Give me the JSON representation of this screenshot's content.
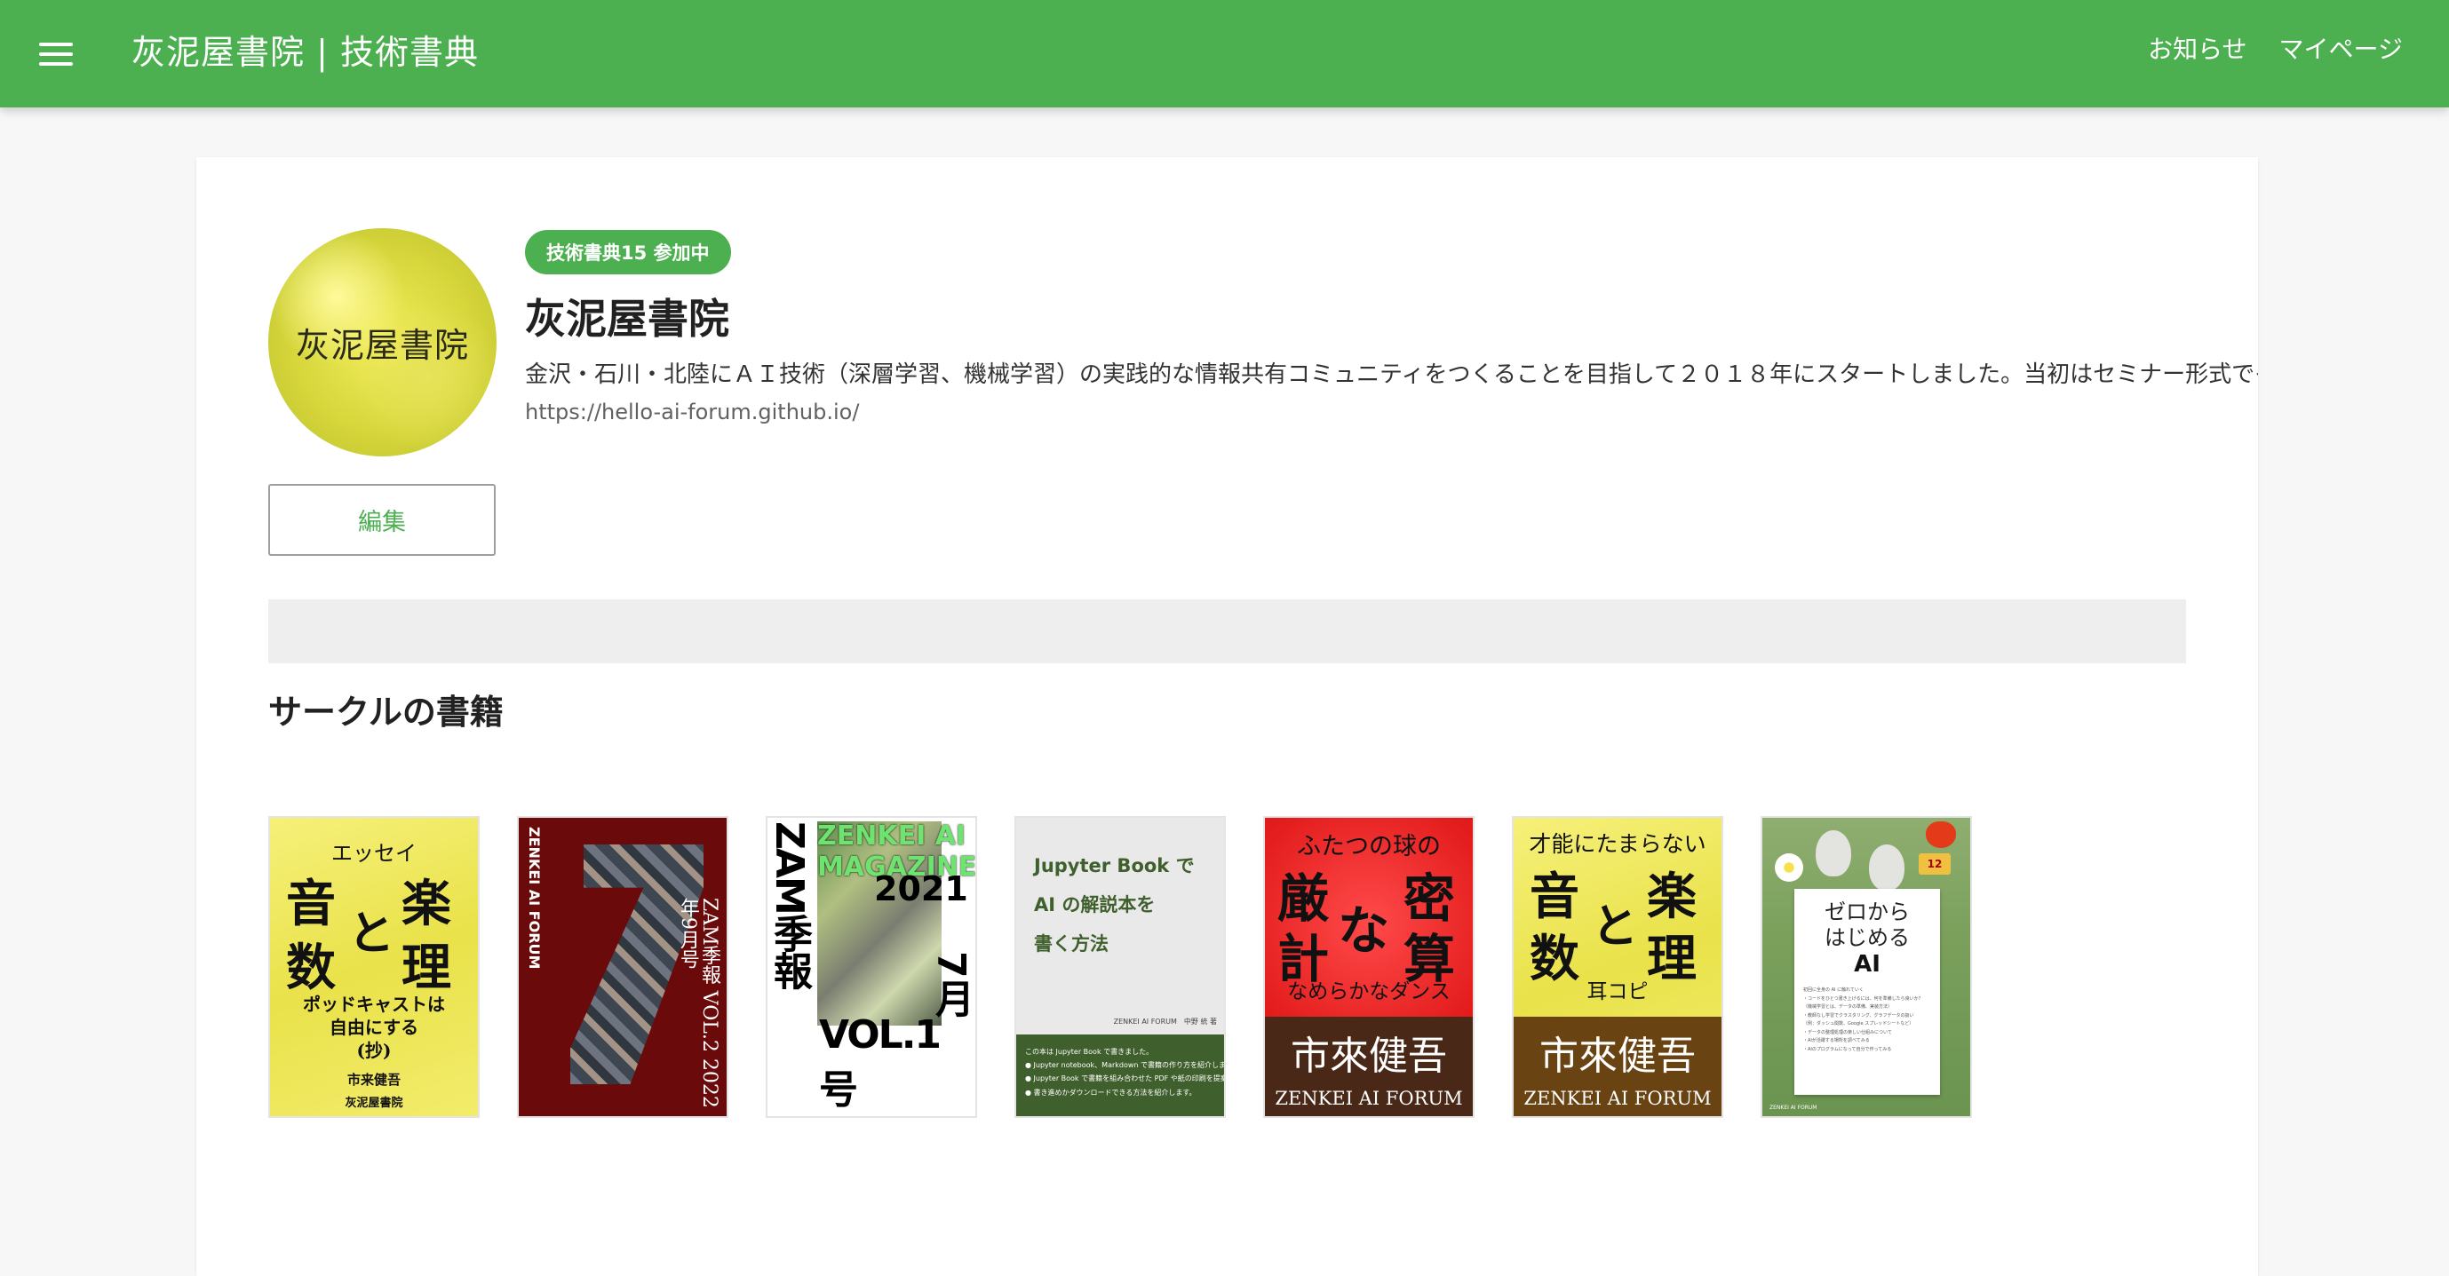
{
  "appbar": {
    "title": "灰泥屋書院 | 技術書典",
    "nav": [
      "お知らせ",
      "マイページ"
    ]
  },
  "circle": {
    "avatar_text": "灰泥屋書院",
    "badge": "技術書典15 参加中",
    "name": "灰泥屋書院",
    "description": "金沢・石川・北陸にＡＩ技術（深層学習、機械学習）の実践的な情報共有コミュニティをつくることを目指して２０１８年にスタートしました。当初はセミナー形式でイベン",
    "url": "https://hello-ai-forum.github.io/",
    "edit_label": "編集"
  },
  "section": {
    "title": "サークルの書籍"
  },
  "books": {
    "b1": {
      "top": "エッセイ",
      "c1": "音",
      "c2": "楽",
      "c3": "と",
      "c4": "数",
      "c5": "理",
      "sub1": "ポッドキャストは",
      "sub2": "自由にする",
      "sub3": "(抄)",
      "author": "市来健吾",
      "publisher": "灰泥屋書院"
    },
    "b2": {
      "vt": "ZENKEI AI FORUM",
      "vtitle": "ZAM季報 VOL.2 2022年9月号"
    },
    "b3": {
      "vbig": "ZAM季報",
      "green": "ZENKEI AI MAGAZINE",
      "year": "2021",
      "month": "7月",
      "vol": "VOL.1号"
    },
    "b4": {
      "l1": "Jupyter Book で",
      "l2": "AI の解説本を",
      "l3": "書く方法",
      "meta": "ZENKEI AI FORUM　中野 統 著",
      "f1": "この本は Jupyter Book で書きました。",
      "f2": "● Jupyter notebook、Markdown で書籍の作り方を紹介します。",
      "f3": "● Jupyter Book で書籍を組み合わせた PDF や紙の印刷を提案します。",
      "f4": "● 書き進めかダウンロードできる方法を紹介します。"
    },
    "b5": {
      "top": "ふたつの球の",
      "c1": "厳",
      "c2": "密",
      "c3": "な",
      "c4": "計",
      "c5": "算",
      "sub": "なめらかなダンス",
      "author": "市來健吾",
      "forum": "ZENKEI AI FORUM"
    },
    "b6": {
      "top": "才能にたまらない",
      "c1": "音",
      "c2": "楽",
      "c3": "と",
      "c4": "数",
      "c5": "理",
      "sub": "耳コピ",
      "author": "市來健吾",
      "forum": "ZENKEI AI FORUM"
    },
    "b7": {
      "title1": "ゼロから",
      "title2": "はじめる",
      "ai": "AI",
      "badge": "12",
      "lines": [
        "初回に全身の AI に触れていく",
        "・コードをひとつ書き上げるには、何を準備したら良いか？",
        "（機械学習とは、データの準備、実装方法）",
        "・教師なし学習でクラスタリング、グラフデータの扱い",
        "（例：ダッシュ関数、Google スプレッドシートなど）",
        "・データの整理処理の楽しい仕組みについて",
        "・AIが活躍する場所を調べてみる",
        "・AIのプログラムになって自分で作ってみる"
      ],
      "foot": "ZENKEI AI FORUM"
    }
  }
}
